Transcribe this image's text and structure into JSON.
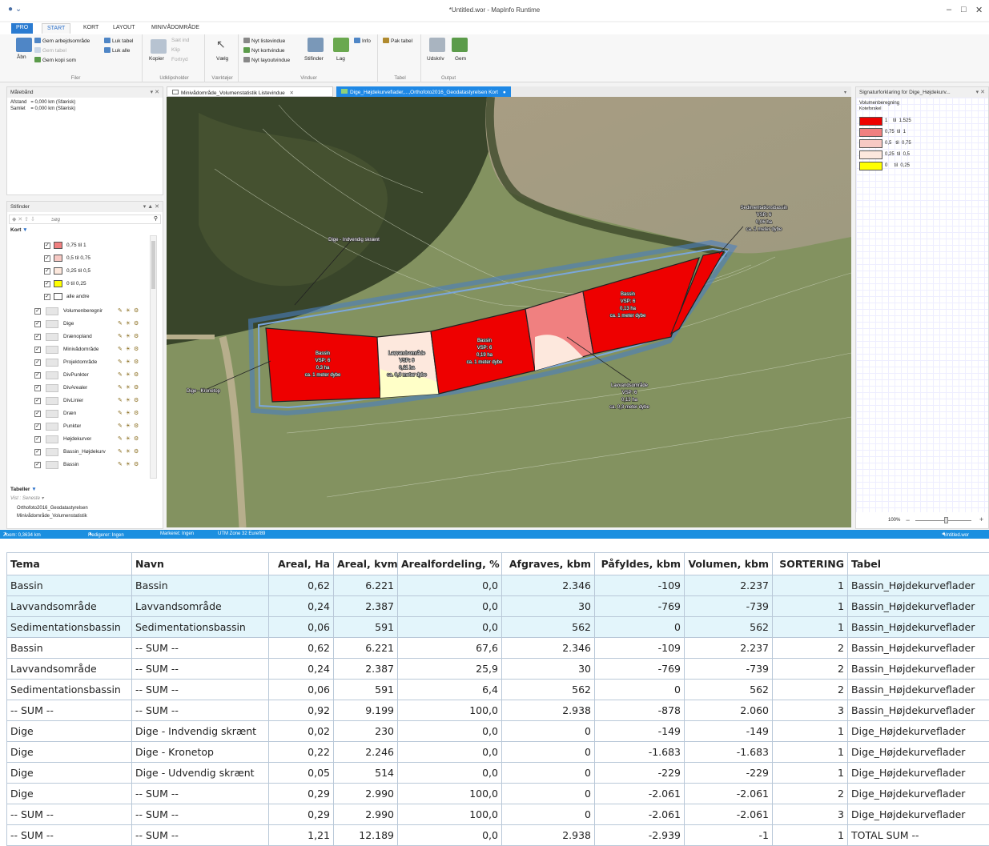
{
  "window": {
    "title": "*Untitled.wor - MapInfo Runtime"
  },
  "ribbon": {
    "tabs": [
      "PRO",
      "START",
      "KORT",
      "LAYOUT",
      "MINIVÅDOMRÅDE"
    ],
    "groups": {
      "filer": {
        "label": "Filer",
        "open": "Åbn",
        "items": [
          "Gem arbejdsområde",
          "Gem tabel",
          "Gem kopi som",
          "Luk tabel",
          "Luk alle"
        ]
      },
      "udklip": {
        "label": "Udklipsholder",
        "copy": "Kopier",
        "items": [
          "Sæt ind",
          "Klip",
          "Fortryd"
        ]
      },
      "vaerktoejer": {
        "label": "Værktøjer",
        "select": "Vælg"
      },
      "vinduer": {
        "label": "Vinduer",
        "items": [
          "Nyt listevindue",
          "Nyt kortvindue",
          "Nyt layoutvindue"
        ],
        "stifinder": "Stifinder",
        "lag": "Lag",
        "info": "Info"
      },
      "tabel": {
        "label": "Tabel",
        "pak": "Pak tabel"
      },
      "output": {
        "label": "Output",
        "print": "Udskriv",
        "save": "Gem"
      }
    }
  },
  "measure_panel": {
    "title": "Målebånd",
    "afstand": "Afstand   = 0,000 km (Sfærisk)",
    "samlet": "Samlet    = 0,000 km (Sfærisk)"
  },
  "explorer": {
    "title": "Stifinder",
    "search_placeholder": "Søg",
    "kort_label": "Kort",
    "theme_items": [
      {
        "label": "0,75 til 1",
        "color": "#f08080"
      },
      {
        "label": "0,5 til 0,75",
        "color": "#f7c9c4"
      },
      {
        "label": "0,25 til 0,5",
        "color": "#fde8dd"
      },
      {
        "label": "0 til 0,25",
        "color": "#ffff00"
      },
      {
        "label": "alle andre",
        "color": "#ffffff"
      }
    ],
    "layers": [
      "Volumenberegnir",
      "Dige",
      "Drænopland",
      "Minivådområde",
      "Projektområde",
      "DivPunkter",
      "DivArealer",
      "DivLinier",
      "Dræn",
      "Punkter",
      "Højdekurver",
      "Bassin_Højdekurv",
      "Bassin"
    ],
    "tables_label": "Tabeller",
    "vist_label": "Vist : Seneste",
    "tables": [
      "Orthofoto2016_Geodatastyrelsen",
      "Minivådområde_Volumenstatistik"
    ]
  },
  "doc_tabs": {
    "list": "Minivådområde_Volumenstatistik Listevindue",
    "map": "Dige_Højdekurveflader,...,Orthofoto2016_Geodatastyrelsen Kort"
  },
  "map_labels": {
    "bassin1": [
      "Bassin",
      "VSP: 6",
      "0,3 ha",
      "ca. 1 meter dybe"
    ],
    "lavvand1": [
      "Lavvandsområde",
      "VSP: 6",
      "0,11 ha",
      "ca. 0,3 meter dybe"
    ],
    "bassin2": [
      "Bassin",
      "VSP: 6",
      "0,19 ha",
      "ca. 1 meter dybe"
    ],
    "bassin3": [
      "Bassin",
      "VSP: 6",
      "0,13 ha",
      "ca. 1 meter dybe"
    ],
    "lavvand2": [
      "Lavvandsområde",
      "VSP: 6",
      "0,13 ha",
      "ca. 0,3 meter dybe"
    ],
    "sediment": [
      "Sedimentationsbassin",
      "VSP: 6",
      "0,06 ha",
      "ca. 1 meter dybe"
    ],
    "dige_indv": "Dige - Indvendig skrænt",
    "dige_krone": "Dige - Kronetop"
  },
  "legend": {
    "title": "Signaturforklaring for Dige_Højdekurv...",
    "heading1": "Volumenberegning",
    "heading2": "Koteforskel",
    "items": [
      {
        "label": "1    til  1.525",
        "color": "#ee0000"
      },
      {
        "label": "0,75  til  1",
        "color": "#f08080"
      },
      {
        "label": "0,5   til  0,75",
        "color": "#f7c9c4"
      },
      {
        "label": "0,25  til  0,5",
        "color": "#fde8dd"
      },
      {
        "label": "0     til  0,25",
        "color": "#ffff00"
      }
    ],
    "zoom": "100%"
  },
  "statusbar": {
    "zoom": "Zoom: 0,3634 km",
    "redigerer": "Redigerer: Ingen",
    "markeret": "Markeret: Ingen",
    "projection": "UTM Zone 32 Euref89",
    "workspace": "*Untitled.wor"
  },
  "table": {
    "columns": [
      "Tema",
      "Navn",
      "Areal, Ha",
      "Areal, kvm",
      "Arealfordeling, %",
      "Afgraves, kbm",
      "Påfyldes, kbm",
      "Volumen, kbm",
      "SORTERING",
      "Tabel"
    ],
    "rows": [
      [
        "Bassin",
        "Bassin",
        "0,62",
        "6.221",
        "0,0",
        "2.346",
        "-109",
        "2.237",
        "1",
        "Bassin_Højdekurveflader"
      ],
      [
        "Lavvandsområde",
        "Lavvandsområde",
        "0,24",
        "2.387",
        "0,0",
        "30",
        "-769",
        "-739",
        "1",
        "Bassin_Højdekurveflader"
      ],
      [
        "Sedimentationsbassin",
        "Sedimentationsbassin",
        "0,06",
        "591",
        "0,0",
        "562",
        "0",
        "562",
        "1",
        "Bassin_Højdekurveflader"
      ],
      [
        "Bassin",
        "-- SUM --",
        "0,62",
        "6.221",
        "67,6",
        "2.346",
        "-109",
        "2.237",
        "2",
        "Bassin_Højdekurveflader"
      ],
      [
        "Lavvandsområde",
        "-- SUM --",
        "0,24",
        "2.387",
        "25,9",
        "30",
        "-769",
        "-739",
        "2",
        "Bassin_Højdekurveflader"
      ],
      [
        "Sedimentationsbassin",
        "-- SUM --",
        "0,06",
        "591",
        "6,4",
        "562",
        "0",
        "562",
        "2",
        "Bassin_Højdekurveflader"
      ],
      [
        "-- SUM --",
        "-- SUM --",
        "0,92",
        "9.199",
        "100,0",
        "2.938",
        "-878",
        "2.060",
        "3",
        "Bassin_Højdekurveflader"
      ],
      [
        "Dige",
        "Dige - Indvendig skrænt",
        "0,02",
        "230",
        "0,0",
        "0",
        "-149",
        "-149",
        "1",
        "Dige_Højdekurveflader"
      ],
      [
        "Dige",
        "Dige - Kronetop",
        "0,22",
        "2.246",
        "0,0",
        "0",
        "-1.683",
        "-1.683",
        "1",
        "Dige_Højdekurveflader"
      ],
      [
        "Dige",
        "Dige - Udvendig skrænt",
        "0,05",
        "514",
        "0,0",
        "0",
        "-229",
        "-229",
        "1",
        "Dige_Højdekurveflader"
      ],
      [
        "Dige",
        "-- SUM --",
        "0,29",
        "2.990",
        "100,0",
        "0",
        "-2.061",
        "-2.061",
        "2",
        "Dige_Højdekurveflader"
      ],
      [
        "-- SUM --",
        "-- SUM --",
        "0,29",
        "2.990",
        "100,0",
        "0",
        "-2.061",
        "-2.061",
        "3",
        "Dige_Højdekurveflader"
      ],
      [
        "-- SUM --",
        "-- SUM --",
        "1,21",
        "12.189",
        "0,0",
        "2.938",
        "-2.939",
        "-1",
        "1",
        "TOTAL SUM --"
      ]
    ]
  }
}
